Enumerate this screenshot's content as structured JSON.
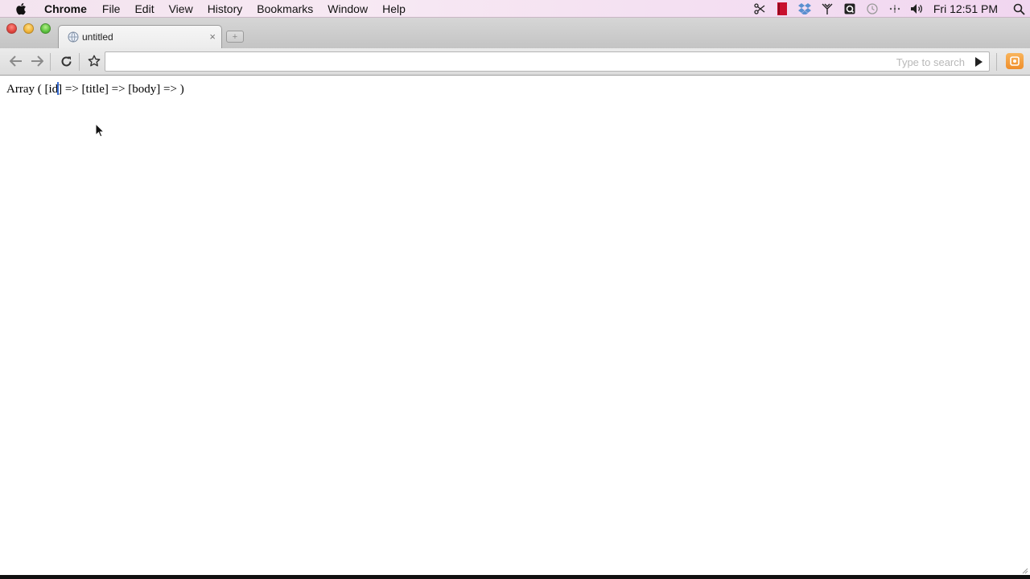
{
  "menubar": {
    "app_name": "Chrome",
    "items": [
      "File",
      "Edit",
      "View",
      "History",
      "Bookmarks",
      "Window",
      "Help"
    ],
    "status_icons": [
      "scissors-icon",
      "red-book-icon",
      "dropbox-icon",
      "antenna-icon",
      "quicksilver-icon",
      "time-machine-icon",
      "menu-extra-icon",
      "volume-icon"
    ],
    "clock": "Fri 12:51 PM",
    "spotlight_icon": "search-icon"
  },
  "window": {
    "traffic_lights": [
      "close",
      "minimize",
      "zoom"
    ]
  },
  "tab": {
    "title": "untitled",
    "close_glyph": "×",
    "new_tab_glyph": "+"
  },
  "toolbar": {
    "address_value": "",
    "search_placeholder": "Type to search",
    "accent_extension_color": "#ef8e2b"
  },
  "page": {
    "output_prefix": "Array ( [id",
    "output_suffix": "] => [title] => [body] => )"
  }
}
